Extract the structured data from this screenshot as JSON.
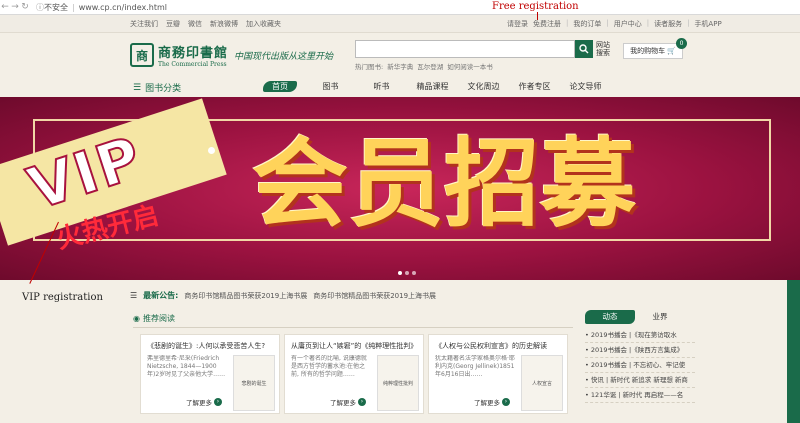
{
  "browser": {
    "security": "不安全",
    "url": "www.cp.cn/index.html"
  },
  "topbar": {
    "left": [
      "关注我们",
      "豆瓣",
      "微信",
      "新浪微博",
      "加入收藏夹"
    ],
    "right": [
      "请登录",
      "免费注册",
      "我的订单",
      "用户中心",
      "读者服务",
      "手机APP"
    ]
  },
  "annotations": {
    "free": "Free registration",
    "vip": "VIP registration"
  },
  "header": {
    "logo_cn": "商務印書館",
    "logo_en": "The Commercial Press",
    "slogan": "中国现代出版从这里开始",
    "search_placeholder": "",
    "search_label": "网站搜索",
    "hot_label": "热门图书:",
    "hot_items": [
      "新华字典",
      "瓦尔登湖",
      "如何阅读一本书"
    ],
    "cart_label": "我的购物车",
    "cart_count": "0"
  },
  "nav": {
    "category": "图书分类",
    "items": [
      "首页",
      "图书",
      "听书",
      "精品课程",
      "文化周边",
      "作者专区",
      "论文导师"
    ],
    "active_index": 0
  },
  "banner": {
    "vip": "VIP",
    "sub": "火热开启",
    "main": "会员招募"
  },
  "ticker": {
    "label": "最新公告:",
    "items": [
      "商务印书馆精品图书荣获2019上海书展",
      "商务印书馆精品图书荣获2019上海书展"
    ]
  },
  "recommend": {
    "title": "推荐阅读",
    "cards": [
      {
        "title": "《悲剧的诞生》:人何以承受悲苦人生?",
        "text": "弗里德里希·尼采(Friedrich Nietzsche, 1844—1900年)2岁时见了父亲他大学……",
        "thumb": "悲剧的诞生",
        "more": "了解更多"
      },
      {
        "title": "从庸页到让人“嫉窘”的《纯粹理性批判》",
        "text": "有一个著名的比喻, 说康德就是西方哲学的蓄水池:在他之前, 所有的哲学问题……",
        "thumb": "纯粹理性批判",
        "more": "了解更多"
      },
      {
        "title": "《人权与公民权利宣言》的历史解读",
        "text": "犹太籍著名法学家格奥尔格·耶利内克(Georg Jellinek)1851年6月16日出……",
        "thumb": "人权宣言",
        "more": "了解更多"
      }
    ]
  },
  "side": {
    "tabs": [
      "动态",
      "业界"
    ],
    "items": [
      "2019书播会 |《现在第访取水",
      "2019书播会 |《陕西方言集成》",
      "2019书播会 | 不忘初心、牢记使",
      "快讯 | 新时代 新追求 新理想 新商",
      "121华诞 | 新时代 再启程——名"
    ]
  }
}
